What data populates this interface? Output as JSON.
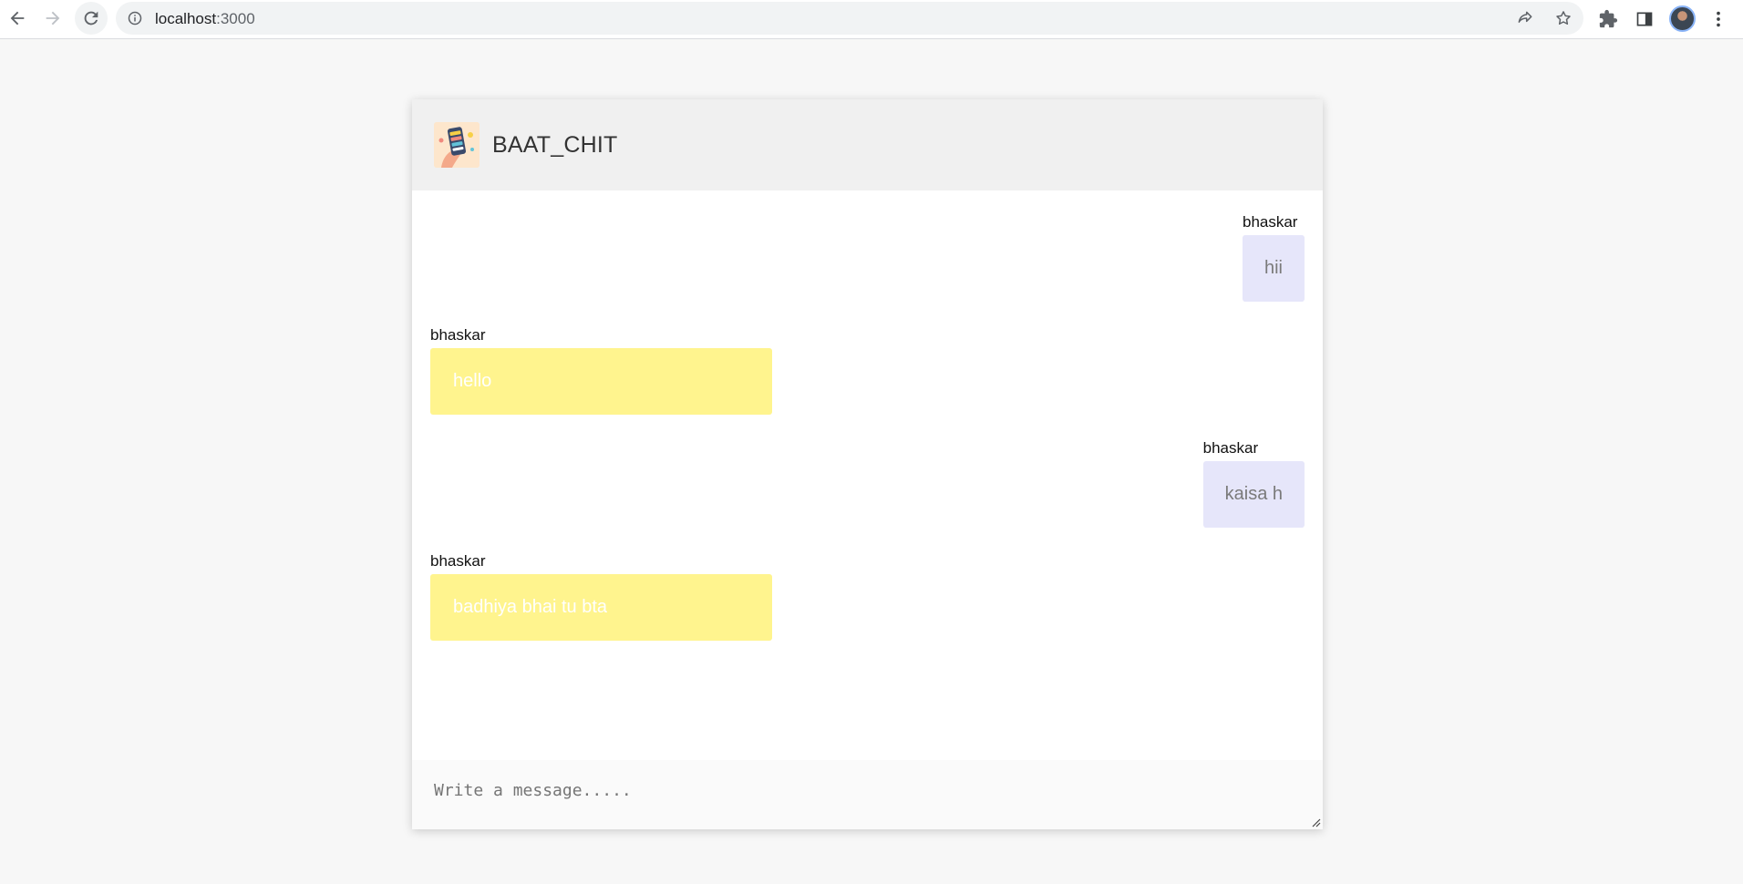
{
  "browser": {
    "url_host": "localhost",
    "url_port": ":3000"
  },
  "app": {
    "title": "BAAT_CHIT"
  },
  "messages": [
    {
      "sender": "bhaskar",
      "text": "hii",
      "side": "right"
    },
    {
      "sender": "bhaskar",
      "text": "hello",
      "side": "left"
    },
    {
      "sender": "bhaskar",
      "text": "kaisa h",
      "side": "right"
    },
    {
      "sender": "bhaskar",
      "text": "badhiya bhai tu bta",
      "side": "left"
    }
  ],
  "composer": {
    "placeholder": "Write a message....."
  },
  "colors": {
    "outgoing_bubble": "#e6e6fa",
    "incoming_bubble": "#fff48e",
    "header_bg": "#f0f0f0"
  }
}
